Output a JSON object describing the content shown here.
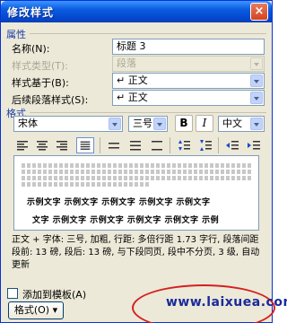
{
  "window": {
    "title": "修改样式",
    "close_glyph": "×"
  },
  "properties": {
    "section_label": "属性",
    "name_label": "名称(N):",
    "name_value": "标题 3",
    "type_label": "样式类型(T):",
    "type_value": "段落",
    "based_on_label": "样式基于(B):",
    "based_on_value": "↵ 正文",
    "next_label": "后续段落样式(S):",
    "next_value": "↵ 正文"
  },
  "format": {
    "section_label": "格式",
    "font": "宋体",
    "size": "三号",
    "bold": "B",
    "italic": "I",
    "script": "中文"
  },
  "preview": {
    "sample_line_1": "示例文字  示例文字  示例文字  示例文字  示例文字",
    "sample_line_2": "文字  示例文字  示例文字  示例文字  示例文字  示例"
  },
  "description": "正文 + 字体: 三号, 加粗, 行距: 多倍行距 1.73 字行, 段落间距段前: 13 磅, 段后: 13 磅, 与下段同页, 段中不分页, 3 级, 自动更新",
  "footer": {
    "add_template_label": "添加到模板(A)",
    "format_button": "格式(O) ▾",
    "watermark": "www.laixuea.com"
  },
  "colors": {
    "titlebar": "#0a5cde",
    "section_label": "#1c3fa8",
    "annotation": "#d42020"
  }
}
